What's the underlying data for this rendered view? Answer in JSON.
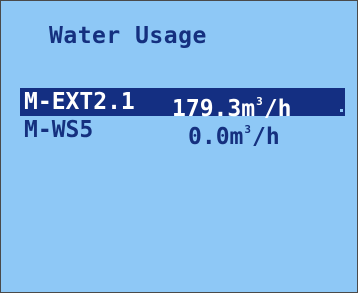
{
  "screen": {
    "title": "Water Usage"
  },
  "meters": [
    {
      "name": "M-EXT2.1",
      "value": "179.3",
      "unit_base": "m",
      "unit_exponent": "3",
      "unit_suffix": "/h",
      "selected": true
    },
    {
      "name": "M-WS5",
      "value": "0.0",
      "unit_base": "m",
      "unit_exponent": "3",
      "unit_suffix": "/h",
      "selected": false
    }
  ],
  "colors": {
    "background": "#8ec8f6",
    "text": "#15307f",
    "selection": "#142f82",
    "selection_text": "#ffffff"
  }
}
